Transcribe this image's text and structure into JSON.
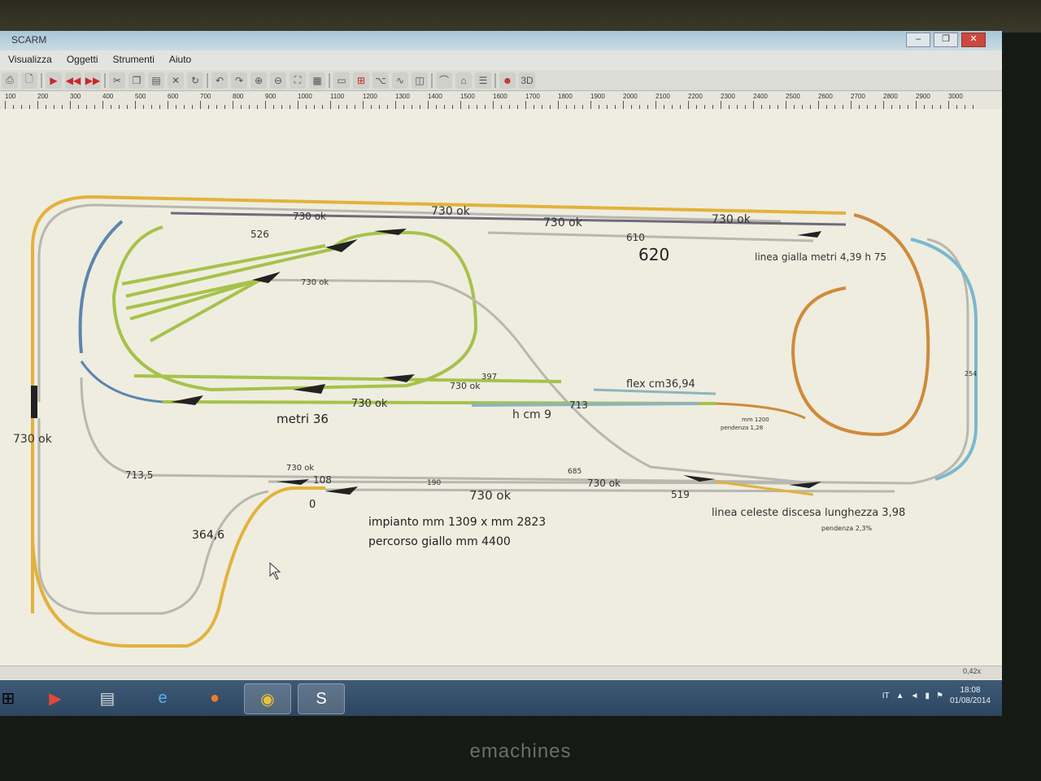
{
  "window": {
    "title": "SCARM"
  },
  "menu": [
    "Visualizza",
    "Oggetti",
    "Strumenti",
    "Aiuto"
  ],
  "ruler": [
    "100",
    "200",
    "300",
    "400",
    "500",
    "600",
    "700",
    "800",
    "900",
    "1000",
    "1100",
    "1200",
    "1300",
    "1400",
    "1500",
    "1600",
    "1700",
    "1800",
    "1900",
    "2000",
    "2100",
    "2200",
    "2300",
    "2400",
    "2500",
    "2600",
    "2700",
    "2800",
    "2900",
    "3000"
  ],
  "labels": {
    "l730_a": "730 ok",
    "l730_b": "730 ok",
    "l730_c": "730 ok",
    "l730_top": "730 ok",
    "l526": "526",
    "l610": "610",
    "l620": "620",
    "linea_gialla": "linea gialla metri 4,39  h 75",
    "l730_d": "730 ok",
    "l397": "397",
    "l730_e": "730 ok",
    "flex": "flex cm36,94",
    "l730_f": "730 ok",
    "metri36": "metri 36",
    "hcm9": "h cm 9",
    "l713": "713",
    "mm1200": "mm 1200",
    "pend128": "pendenza 1,28",
    "l730_left": "730 ok",
    "l7135": "713,5",
    "l730_g": "730 ok",
    "l685": "685",
    "l108": "108",
    "l190": "190",
    "l730_h": "730 ok",
    "l730_i": "730 ok",
    "l519": "519",
    "l0": "0",
    "impianto": "impianto mm 1309 x mm 2823",
    "percorso": "percorso giallo mm 4400",
    "l3646": "364,6",
    "celeste": "linea celeste discesa lunghezza 3,98",
    "pend23": "pendenza 2,3%",
    "l254": "254"
  },
  "status": {
    "zoom": "0,42x"
  },
  "tray": {
    "lang": "IT",
    "time": "18:08",
    "date": "01/08/2014"
  },
  "monitor_brand": "emachines",
  "colors": {
    "yellow_track": "#e3b23c",
    "green_track": "#a6c24a",
    "blue_track": "#5b86b0",
    "grey_track": "#b8b7b0",
    "orange_track": "#d08a3a"
  }
}
